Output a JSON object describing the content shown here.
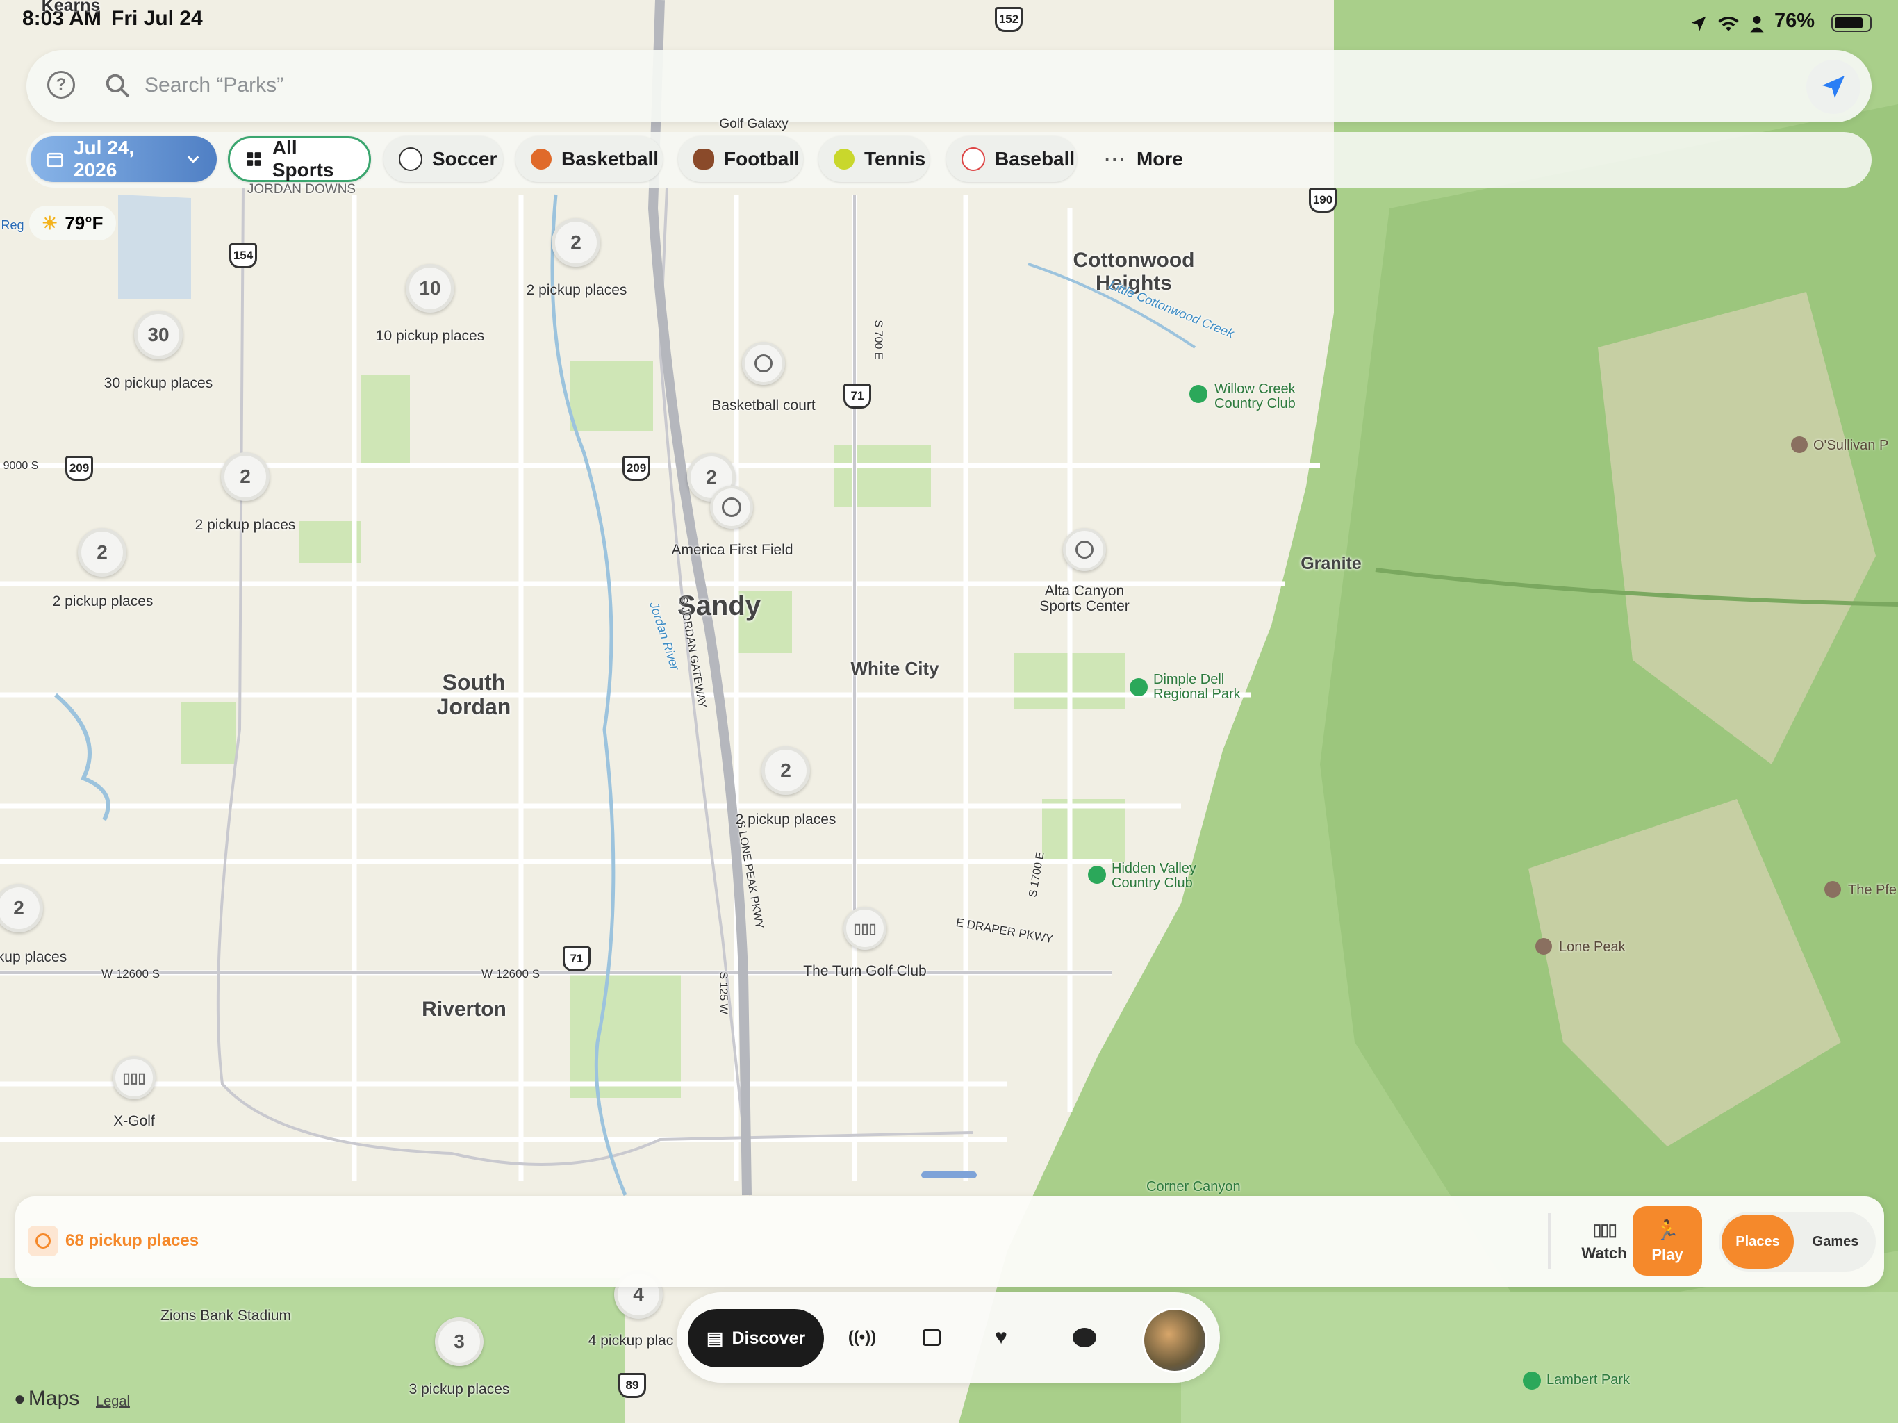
{
  "status_bar": {
    "time": "8:03 AM",
    "date": "Fri Jul 24",
    "battery": "76%"
  },
  "search": {
    "placeholder": "Search “Parks”"
  },
  "weather": {
    "temp": "79°F"
  },
  "filters": {
    "date": "Jul 24, 2026",
    "chips": [
      {
        "label": "All Sports",
        "icon": "grid-icon",
        "selected": true
      },
      {
        "label": "Soccer",
        "icon": "soccer-ball-icon"
      },
      {
        "label": "Basketball",
        "icon": "basketball-icon"
      },
      {
        "label": "Football",
        "icon": "football-icon"
      },
      {
        "label": "Tennis",
        "icon": "tennis-ball-icon"
      },
      {
        "label": "Baseball",
        "icon": "baseball-icon"
      },
      {
        "label": "More",
        "icon": "ellipsis-icon"
      }
    ]
  },
  "map": {
    "clusters": [
      {
        "count": "2",
        "label": "2 pickup places"
      },
      {
        "count": "10",
        "label": "10 pickup places"
      },
      {
        "count": "30",
        "label": "30 pickup places"
      },
      {
        "count": "2",
        "label": "2 pickup places"
      },
      {
        "count": "2",
        "label": "2 pickup places"
      },
      {
        "count": "2",
        "label": ""
      },
      {
        "count": "2",
        "label": "2 pickup places"
      },
      {
        "count": "2",
        "label": "kup places"
      },
      {
        "count": "3",
        "label": "3 pickup places"
      },
      {
        "count": "4",
        "label": "4 pickup plac"
      }
    ],
    "pois": [
      {
        "name": "Basketball court",
        "icon": "basketball-icon"
      },
      {
        "name": "America First Field",
        "icon": "soccer-ball-icon"
      },
      {
        "name": "Alta Canyon\nSports Center",
        "icon": "basketball-icon"
      },
      {
        "name": "The Turn Golf Club",
        "icon": "golf-icon"
      },
      {
        "name": "X-Golf",
        "icon": "golf-icon"
      }
    ],
    "places": {
      "sandy": "Sandy",
      "south_jordan": "South\nJordan",
      "riverton": "Riverton",
      "white_city": "White City",
      "cottonwood_heights": "Cottonwood\nHeights",
      "granite": "Granite",
      "jordan_downs": "JORDAN DOWNS",
      "golf_galaxy": "Golf Galaxy",
      "kearns": "Kearns",
      "zions_bank": "Zions Bank Stadium",
      "reg": "Reg"
    },
    "parks": {
      "willow_creek": "Willow Creek\nCountry Club",
      "dimple_dell": "Dimple Dell\nRegional Park",
      "hidden_valley": "Hidden Valley\nCountry Club",
      "corner_canyon": "Corner Canyon",
      "lambert": "Lambert Park"
    },
    "peaks": {
      "osullivan": "O'Sullivan P",
      "the_pfeifferhorn": "The Pfe",
      "lone_peak": "Lone Peak"
    },
    "roads": {
      "s700e": "S 700 E",
      "s1700e": "S 1700 E",
      "jordan_gateway": "S JORDAN GATEWAY",
      "lone_peak_pkwy": "S LONE PEAK PKWY",
      "draper_pkwy": "E DRAPER PKWY",
      "w12600s_a": "W 12600 S",
      "w12600s_b": "W 12600 S",
      "s125w": "S 125 W",
      "9000s": "9000 S",
      "jordan_river": "Jordan River",
      "cottonwood_creek": "Little Cottonwood Creek"
    },
    "shields": [
      "152",
      "154",
      "190",
      "209",
      "209",
      "71",
      "71",
      "89"
    ]
  },
  "bottom_sheet": {
    "count_label": "68 pickup places",
    "watch": "Watch",
    "play": "Play",
    "segment": {
      "places": "Places",
      "games": "Games"
    }
  },
  "dock": {
    "discover": "Discover"
  },
  "attribution": {
    "maps": "Maps",
    "legal": "Legal"
  },
  "colors": {
    "accent": "#f5892b",
    "selected_chip_border": "#3ba66f",
    "date_chip": "#5d8fd3"
  }
}
